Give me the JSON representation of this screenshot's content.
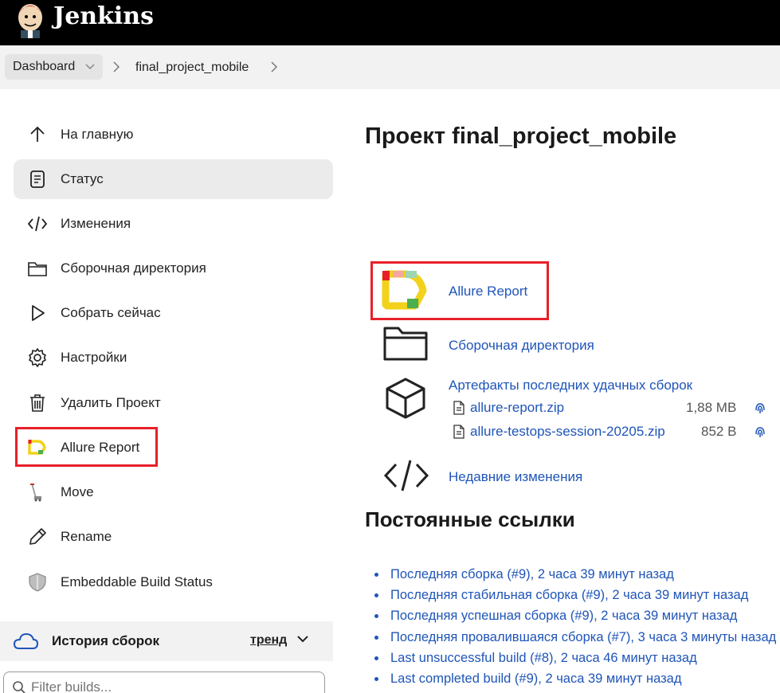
{
  "header": {
    "brand": "Jenkins"
  },
  "breadcrumb": {
    "dashboard": "Dashboard",
    "project": "final_project_mobile"
  },
  "sidebar": {
    "items": [
      {
        "label": "На главную",
        "icon": "arrow-up-icon"
      },
      {
        "label": "Статус",
        "icon": "document-icon"
      },
      {
        "label": "Изменения",
        "icon": "code-icon"
      },
      {
        "label": "Сборочная директория",
        "icon": "folder-icon"
      },
      {
        "label": "Собрать сейчас",
        "icon": "play-icon"
      },
      {
        "label": "Настройки",
        "icon": "gear-icon"
      },
      {
        "label": "Удалить Проект",
        "icon": "trash-icon"
      },
      {
        "label": "Allure Report",
        "icon": "allure-icon"
      },
      {
        "label": "Move",
        "icon": "move-icon"
      },
      {
        "label": "Rename",
        "icon": "pencil-icon"
      },
      {
        "label": "Embeddable Build Status",
        "icon": "shield-icon"
      }
    ],
    "history": {
      "title": "История сборок",
      "trend": "тренд"
    },
    "filter_placeholder": "Filter builds..."
  },
  "main": {
    "title": "Проект final_project_mobile",
    "allure_link": "Allure Report",
    "workspace_link": "Сборочная директория",
    "artifacts_title": "Артефакты последних удачных сборок",
    "artifacts": [
      {
        "name": "allure-report.zip",
        "size": "1,88 MB"
      },
      {
        "name": "allure-testops-session-20205.zip",
        "size": "852 B"
      }
    ],
    "changes_link": "Недавние изменения",
    "permalinks_title": "Постоянные ссылки",
    "permalinks": [
      "Последняя сборка (#9), 2 часа 39 минут назад",
      "Последняя стабильная сборка (#9), 2 часа 39 минут назад",
      "Последняя успешная сборка (#9), 2 часа 39 минут назад",
      "Последняя провалившаяся сборка (#7), 3 часа 3 минуты назад",
      "Last unsuccessful build (#8), 2 часа 46 минут назад",
      "Last completed build (#9), 2 часа 39 минут назад"
    ]
  },
  "colors": {
    "accent_red": "#e8202a",
    "link_blue": "#1f55b8"
  }
}
